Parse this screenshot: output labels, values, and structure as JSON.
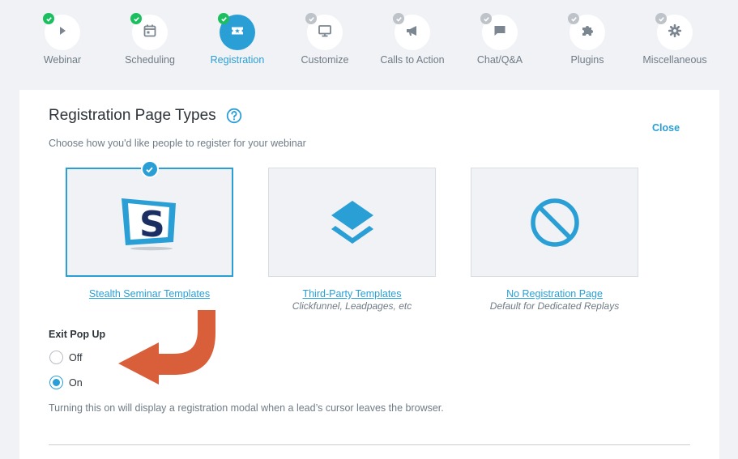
{
  "steps": [
    {
      "label": "Webinar",
      "icon": "play-icon",
      "status": "done"
    },
    {
      "label": "Scheduling",
      "icon": "calendar-icon",
      "status": "done"
    },
    {
      "label": "Registration",
      "icon": "ticket-icon",
      "status": "active"
    },
    {
      "label": "Customize",
      "icon": "monitor-icon",
      "status": "pending"
    },
    {
      "label": "Calls to Action",
      "icon": "megaphone-icon",
      "status": "pending"
    },
    {
      "label": "Chat/Q&A",
      "icon": "chat-icon",
      "status": "pending"
    },
    {
      "label": "Plugins",
      "icon": "puzzle-icon",
      "status": "pending"
    },
    {
      "label": "Miscellaneous",
      "icon": "gear-icon",
      "status": "pending"
    }
  ],
  "main": {
    "title": "Registration Page Types",
    "close_label": "Close",
    "subtitle": "Choose how you'd like people to register for your webinar",
    "options": [
      {
        "label": "Stealth Seminar Templates",
        "sublabel": "",
        "icon": "stealth-seminar-logo",
        "selected": true
      },
      {
        "label": "Third-Party Templates",
        "sublabel": "Clickfunnel, Leadpages, etc",
        "icon": "layers-icon",
        "selected": false
      },
      {
        "label": "No Registration Page",
        "sublabel": "Default for Dedicated Replays",
        "icon": "no-entry-icon",
        "selected": false
      }
    ],
    "exit_popup": {
      "label": "Exit Pop Up",
      "off_label": "Off",
      "on_label": "On",
      "selected": "On",
      "hint": "Turning this on will display a registration modal when a lead’s cursor leaves the browser."
    }
  },
  "colors": {
    "accent": "#2a9fd6",
    "success": "#1bbf5f",
    "arrow": "#d95f3b",
    "background": "#f0f2f5"
  }
}
